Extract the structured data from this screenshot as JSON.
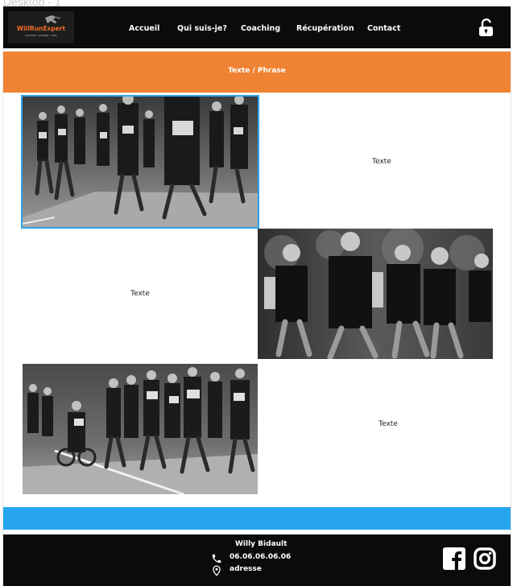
{
  "frame_label": "Desktop - 1",
  "header": {
    "logo_text": "WillRunExpert",
    "logo_tagline": "COACHING • RUNNING • TRAIL",
    "nav": [
      "Accueil",
      "Qui suis-je?",
      "Coaching",
      "Récupération",
      "Contact"
    ],
    "lock_icon": "unlock-icon"
  },
  "banner": {
    "text": "Texte / Phrase"
  },
  "sections": [
    {
      "text": "Texte"
    },
    {
      "text": "Texte"
    },
    {
      "text": "Texte"
    }
  ],
  "footer": {
    "name": "Willy Bidault",
    "phone": "06.06.06.06.06",
    "address": "adresse",
    "icons": [
      "phone-icon",
      "location-pin-icon",
      "facebook-icon",
      "instagram-icon"
    ]
  },
  "colors": {
    "nav_bg": "#0b0b0b",
    "accent_orange": "#ef8233",
    "accent_blue": "#27a6ef"
  }
}
